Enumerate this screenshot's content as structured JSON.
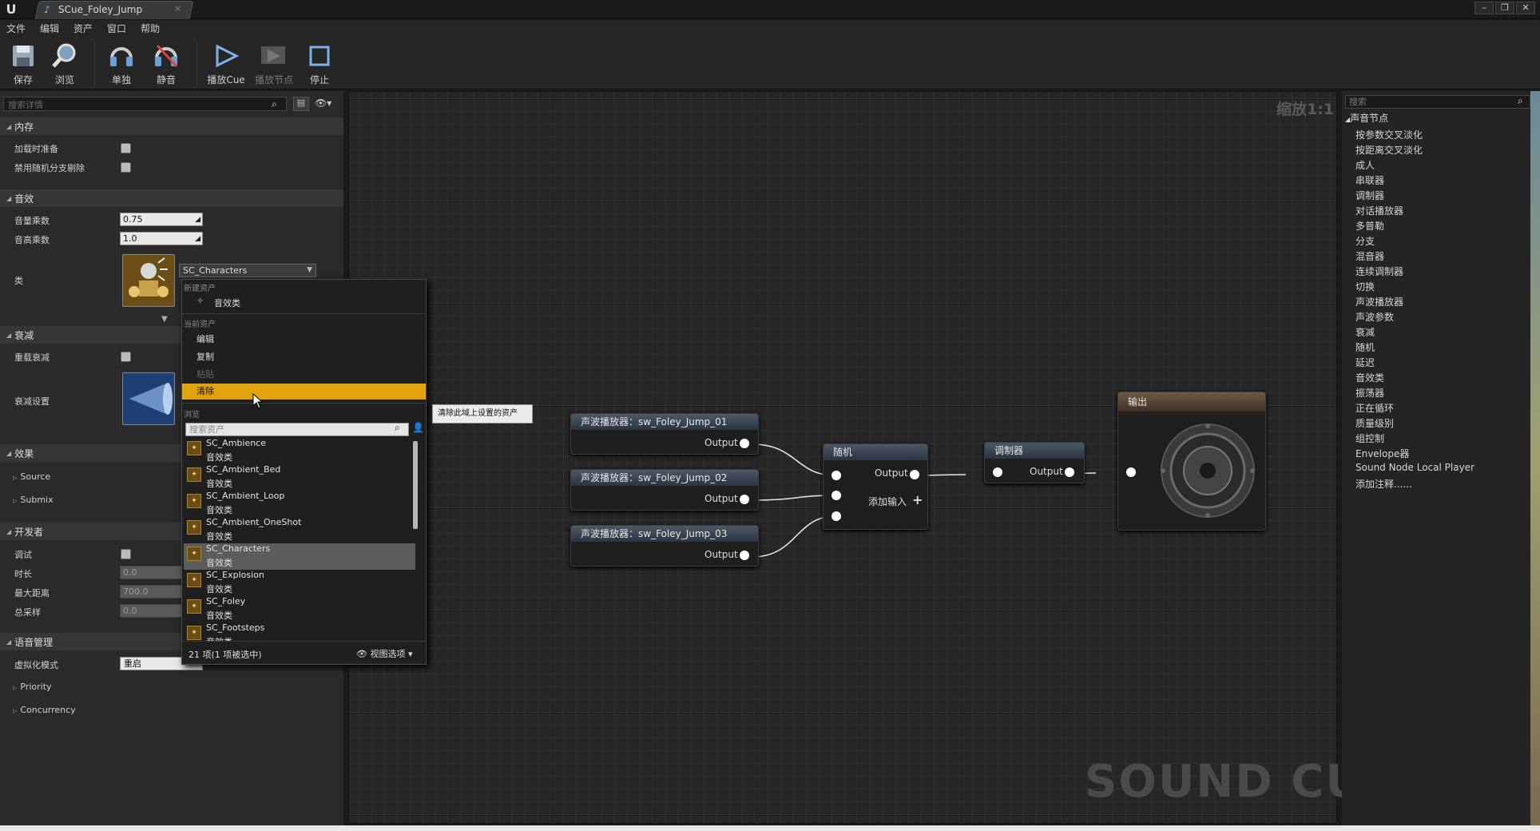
{
  "window": {
    "tab_title": "SCue_Foley_Jump",
    "tab_close": "×",
    "win_min": "–",
    "win_restore": "❐",
    "win_close": "✕"
  },
  "menu": [
    "文件",
    "编辑",
    "资产",
    "窗口",
    "帮助"
  ],
  "toolbar": {
    "save": "保存",
    "browse": "浏览",
    "solo": "单独",
    "mute": "静音",
    "play_cue": "播放Cue",
    "play_node": "播放节点",
    "stop": "停止"
  },
  "details": {
    "search_placeholder": "搜索详情",
    "memory": {
      "title": "内存",
      "load_ready": "加载时准备",
      "disable_random_branch": "禁用随机分支剔除"
    },
    "sound": {
      "title": "音效",
      "volume_mult": "音量乘数",
      "volume_value": "0.75",
      "pitch_mult": "音高乘数",
      "pitch_value": "1.0",
      "class_label": "类",
      "class_value": "SC_Characters"
    },
    "attenuation": {
      "title": "衰减",
      "override": "重载衰减",
      "settings": "衰减设置"
    },
    "effects": {
      "title": "效果",
      "source": "Source",
      "submix": "Submix"
    },
    "developer": {
      "title": "开发者",
      "debug": "调试",
      "duration": "时长",
      "duration_value": "0.0",
      "max_distance": "最大距离",
      "max_distance_value": "700.0",
      "total_samples": "总采样",
      "total_samples_value": "0.0"
    },
    "voice": {
      "title": "语音管理",
      "virtualization": "虚拟化模式",
      "virtualization_value": "重启",
      "priority": "Priority",
      "concurrency": "Concurrency"
    }
  },
  "dropdown": {
    "new_asset_header": "新建资产",
    "new_sound_class": "音效类",
    "current_asset_header": "当前资产",
    "edit": "编辑",
    "copy": "复制",
    "paste": "粘贴",
    "clear": "清除",
    "browse_header": "浏览",
    "asset_search_placeholder": "搜索资产",
    "assets": [
      {
        "name": "SC_Ambience",
        "type": "音效类"
      },
      {
        "name": "SC_Ambient_Bed",
        "type": "音效类"
      },
      {
        "name": "SC_Ambient_Loop",
        "type": "音效类"
      },
      {
        "name": "SC_Ambient_OneShot",
        "type": "音效类"
      },
      {
        "name": "SC_Characters",
        "type": "音效类"
      },
      {
        "name": "SC_Explosion",
        "type": "音效类"
      },
      {
        "name": "SC_Foley",
        "type": "音效类"
      },
      {
        "name": "SC_Footsteps",
        "type": "音效类"
      }
    ],
    "selected_index": 4,
    "count_text": "21 项(1 项被选中)",
    "view_options": "视图选项"
  },
  "tooltip": "清除此域上设置的资产",
  "graph": {
    "zoom": "缩放1:1",
    "watermark": "SOUND CUE",
    "nodes": {
      "wave1": {
        "title": "声波播放器：sw_Foley_Jump_01",
        "output": "Output"
      },
      "wave2": {
        "title": "声波播放器：sw_Foley_Jump_02",
        "output": "Output"
      },
      "wave3": {
        "title": "声波播放器：sw_Foley_Jump_03",
        "output": "Output"
      },
      "random": {
        "title": "随机",
        "output": "Output",
        "add_input": "添加输入"
      },
      "modulator": {
        "title": "调制器",
        "output": "Output"
      },
      "output": {
        "title": "输出"
      }
    }
  },
  "palette": {
    "search_placeholder": "搜索",
    "category": "声音节点",
    "items": [
      "按参数交叉淡化",
      "按距离交叉淡化",
      "成人",
      "串联器",
      "调制器",
      "对话播放器",
      "多普勒",
      "分支",
      "混音器",
      "连续调制器",
      "切换",
      "声波播放器",
      "声波参数",
      "衰减",
      "随机",
      "延迟",
      "音效类",
      "振荡器",
      "正在循环",
      "质量级别",
      "组控制",
      "Envelope器",
      "Sound Node Local Player",
      "添加注释......"
    ]
  }
}
